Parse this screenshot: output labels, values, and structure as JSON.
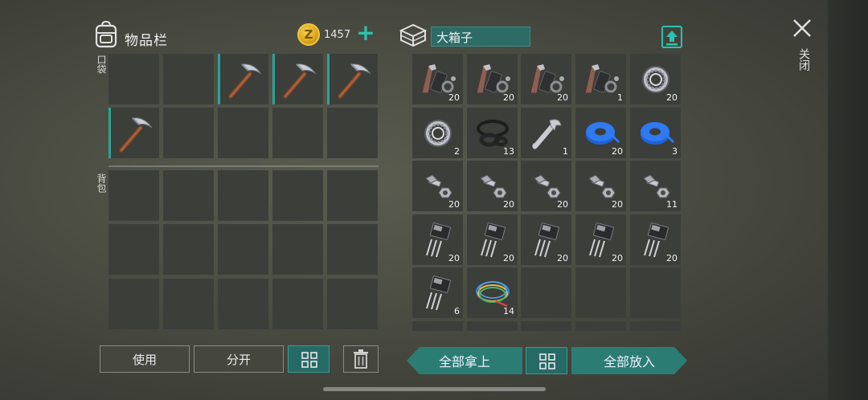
{
  "left_panel": {
    "title": "物品栏",
    "coins": "1457",
    "pocket_label": "口袋",
    "backpack_label": "背包",
    "pocket_items": [
      {
        "icon": "pickaxe-icon"
      },
      {
        "icon": "pickaxe-icon"
      },
      {
        "icon": "pickaxe-icon"
      },
      {
        "icon": "pickaxe-icon"
      }
    ]
  },
  "right_panel": {
    "container_name": "大箱子",
    "items": [
      {
        "icon": "parts-kit-icon",
        "qty": "20"
      },
      {
        "icon": "parts-kit-icon",
        "qty": "20"
      },
      {
        "icon": "parts-kit-icon",
        "qty": "20"
      },
      {
        "icon": "parts-kit-icon",
        "qty": "1"
      },
      {
        "icon": "bearing-icon",
        "qty": "20"
      },
      {
        "icon": "bearing-icon",
        "qty": "2"
      },
      {
        "icon": "rubber-seal-icon",
        "qty": "13"
      },
      {
        "icon": "wrench-icon",
        "qty": "1"
      },
      {
        "icon": "blue-tape-icon",
        "qty": "20"
      },
      {
        "icon": "blue-tape-icon",
        "qty": "3"
      },
      {
        "icon": "bolt-nut-icon",
        "qty": "20"
      },
      {
        "icon": "bolt-nut-icon",
        "qty": "20"
      },
      {
        "icon": "bolt-nut-icon",
        "qty": "20"
      },
      {
        "icon": "bolt-nut-icon",
        "qty": "20"
      },
      {
        "icon": "bolt-nut-icon",
        "qty": "11"
      },
      {
        "icon": "transistor-icon",
        "qty": "20"
      },
      {
        "icon": "transistor-icon",
        "qty": "20"
      },
      {
        "icon": "transistor-icon",
        "qty": "20"
      },
      {
        "icon": "transistor-icon",
        "qty": "20"
      },
      {
        "icon": "transistor-icon",
        "qty": "20"
      },
      {
        "icon": "transistor-icon",
        "qty": "6"
      },
      {
        "icon": "wire-coil-icon",
        "qty": "14"
      }
    ]
  },
  "close": {
    "label": "关闭"
  },
  "buttons": {
    "use": "使用",
    "split": "分开",
    "take_all": "全部拿上",
    "put_all": "全部放入"
  },
  "colors": {
    "accent": "#2aa39a",
    "slot": "#3c3e3a",
    "coin": "#e5b52a"
  }
}
